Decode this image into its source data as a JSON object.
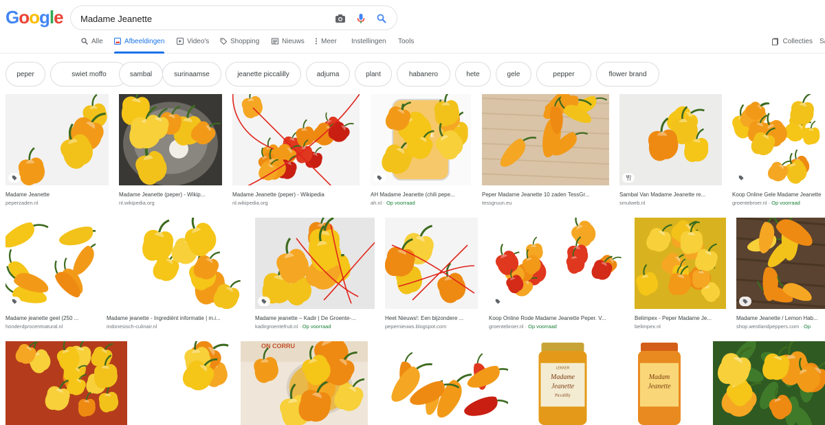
{
  "search": {
    "query": "Madame Jeanette"
  },
  "logo": {
    "text": "Google"
  },
  "tabs": [
    {
      "label": "Alle"
    },
    {
      "label": "Afbeeldingen"
    },
    {
      "label": "Video's"
    },
    {
      "label": "Shopping"
    },
    {
      "label": "Nieuws"
    },
    {
      "label": "Meer"
    },
    {
      "label": "Instellingen"
    },
    {
      "label": "Tools"
    }
  ],
  "right": {
    "collecties": "Collecties",
    "sa": "Sa"
  },
  "chips": [
    "peper",
    "swiet moffo",
    "sambal",
    "surinaamse",
    "jeanette piccalilly",
    "adjuma",
    "plant",
    "habanero",
    "hete",
    "gele",
    "pepper",
    "flower brand"
  ],
  "results": [
    {
      "title": "Madame Jeanette",
      "source": "peperzaden.nl",
      "pre": "",
      "badge": "tag-icon",
      "colors": [
        "#f2f2f2",
        "#f2c31a"
      ]
    },
    {
      "title": "Madame Jeanette (peper) - Wikip...",
      "source": "nl.wikipedia.org",
      "pre": "",
      "badge": "",
      "colors": [
        "#3a3834",
        "#f0b72a"
      ]
    },
    {
      "title": "Madame Jeanette (peper) - Wikipedia",
      "source": "nl.wikipedia.org",
      "pre": "",
      "badge": "",
      "colors": [
        "#f4f4f4",
        "#cc2020"
      ]
    },
    {
      "title": "AH Madame Jeanette (chili pepe...",
      "source": "ah.nl",
      "pre": "Op voorraad",
      "badge": "tag-icon",
      "colors": [
        "#fafafa",
        "#f5b833"
      ]
    },
    {
      "title": "Peper Madame Jeanette 10 zaden TessGr...",
      "source": "tessgruun.eu",
      "pre": "",
      "badge": "",
      "colors": [
        "#d9c4a8",
        "#f4d23a"
      ]
    },
    {
      "title": "Sambal Van Madame Jeanette re...",
      "source": "smulweb.nl",
      "pre": "",
      "badge": "fork-icon",
      "colors": [
        "#ececea",
        "#f2c419"
      ]
    },
    {
      "title": "Koop Online Gele Madame Jeanette",
      "source": "groentebroer.nl",
      "pre": "Op voorraad",
      "badge": "tag-icon",
      "colors": [
        "#ffffff",
        "#f6ad14"
      ]
    },
    {
      "title": "Madame jeanette geel (250 ...",
      "source": "honderdprocentnatural.nl",
      "pre": "",
      "badge": "tag-icon",
      "colors": [
        "#ffffff",
        "#f5b835"
      ]
    },
    {
      "title": "Madame jeanette - Ingrediënt informatie | m.i...",
      "source": "indonesisch-culinair.nl",
      "pre": "",
      "badge": "",
      "colors": [
        "#ffffff",
        "#f29a18"
      ]
    },
    {
      "title": "Madame jeanette – Kadir | De Groente-...",
      "source": "kadirgroentefruit.nl",
      "pre": "Op voorraad",
      "badge": "tag-icon",
      "colors": [
        "#e6e6e6",
        "#f0b424"
      ]
    },
    {
      "title": "Heet Nieuws!: Een bijzondere ...",
      "source": "pepernieuws.blogspot.com",
      "pre": "",
      "badge": "",
      "colors": [
        "#f4f4f4",
        "#f2a01b"
      ]
    },
    {
      "title": "Koop Online Rode Madame Jeanette Peper. V...",
      "source": "groentebroer.nl",
      "pre": "Op voorraad",
      "badge": "tag-icon",
      "colors": [
        "#ffffff",
        "#e02a18"
      ]
    },
    {
      "title": "Belimpex - Peper Madame Je...",
      "source": "belimpex.nl",
      "pre": "",
      "badge": "",
      "colors": [
        "#d8b31f",
        "#f3d03a"
      ]
    },
    {
      "title": "Madame Jeanette / Lemon Hab...",
      "source": "shop.westlandpeppers.com",
      "pre": "Op",
      "badge": "tag-icon",
      "colors": [
        "#6a5239",
        "#f4c72a"
      ]
    },
    {
      "title": "",
      "source": "",
      "pre": "",
      "badge": "",
      "colors": [
        "#b43c1c",
        "#e8671a"
      ]
    },
    {
      "title": "",
      "source": "",
      "pre": "",
      "badge": "",
      "colors": [
        "#ffffff",
        "#f6c317"
      ]
    },
    {
      "title": "",
      "source": "",
      "pre": "",
      "badge": "",
      "colors": [
        "#efe6d9",
        "#f2c74a"
      ]
    },
    {
      "title": "",
      "source": "",
      "pre": "",
      "badge": "",
      "colors": [
        "#ffffff",
        "#d93a1e"
      ]
    },
    {
      "title": "",
      "source": "",
      "pre": "",
      "badge": "",
      "colors": [
        "#ffffff",
        "#e49a18"
      ]
    },
    {
      "title": "",
      "source": "",
      "pre": "",
      "badge": "",
      "colors": [
        "#ffffff",
        "#e88a20"
      ]
    },
    {
      "title": "",
      "source": "",
      "pre": "",
      "badge": "",
      "colors": [
        "#2f5a22",
        "#f2b51b"
      ]
    }
  ],
  "jar_labels": [
    {
      "brand": "LEKKER",
      "name": "Madame",
      "name2": "Jeanette",
      "sub": "Piccalilly"
    },
    {
      "brand": "",
      "name": "Madam",
      "name2": "Jeanette",
      "sub": ""
    }
  ],
  "colors": {
    "accent": "#1a73e8",
    "green": "#188038",
    "scribble": "#e0241b"
  }
}
